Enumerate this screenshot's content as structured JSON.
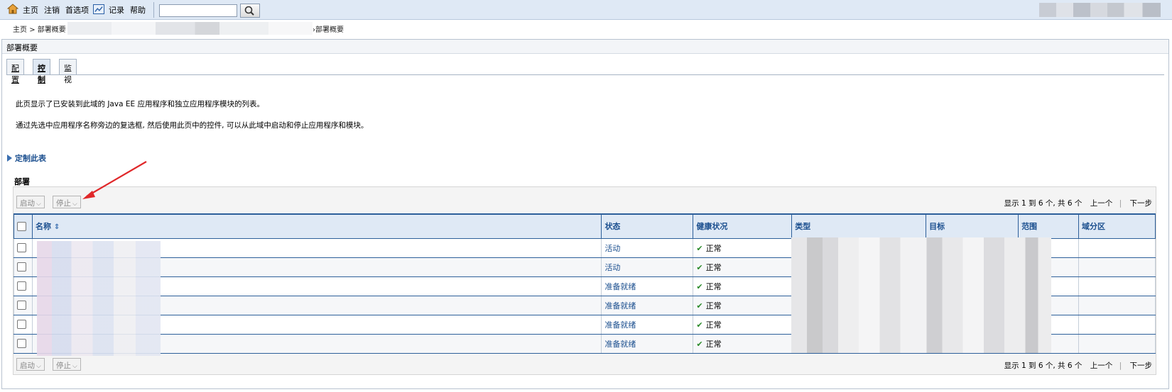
{
  "toolbar": {
    "home": "主页",
    "logout": "注销",
    "preferences": "首选项",
    "record": "记录",
    "help": "帮助",
    "search_value": ""
  },
  "breadcrumb": {
    "home": "主页",
    "sep": ">",
    "deploy": "部署概要 :",
    "tail": "›部署概要"
  },
  "panel": {
    "title": "部署概要",
    "tabs": [
      "配置",
      "控制",
      "监视"
    ],
    "active_tab": "控制",
    "desc1": "此页显示了已安装到此域的 Java EE 应用程序和独立应用程序模块的列表。",
    "desc2": "通过先选中应用程序名称旁边的复选框, 然后使用此页中的控件, 可以从此域中启动和停止应用程序和模块。",
    "customize": "定制此表",
    "section": "部署"
  },
  "controls": {
    "start": "启动",
    "stop": "停止"
  },
  "pager": {
    "summary": "显示 1 到 6 个, 共 6 个",
    "prev": "上一个",
    "next": "下一步"
  },
  "table": {
    "headers": {
      "name": "名称",
      "state": "状态",
      "health": "健康状况",
      "type": "类型",
      "target": "目标",
      "scope": "范围",
      "partition": "域分区"
    },
    "rows": [
      {
        "state": "活动",
        "health": "正常"
      },
      {
        "state": "活动",
        "health": "正常"
      },
      {
        "state": "准备就绪",
        "health": "正常"
      },
      {
        "state": "准备就绪",
        "health": "正常"
      },
      {
        "state": "准备就绪",
        "health": "正常"
      },
      {
        "state": "准备就绪",
        "health": "正常"
      }
    ]
  },
  "colors": {
    "header_bg": "#dfe9f5",
    "link": "#1b4f8f",
    "annotation_arrow": "#e0282a"
  }
}
